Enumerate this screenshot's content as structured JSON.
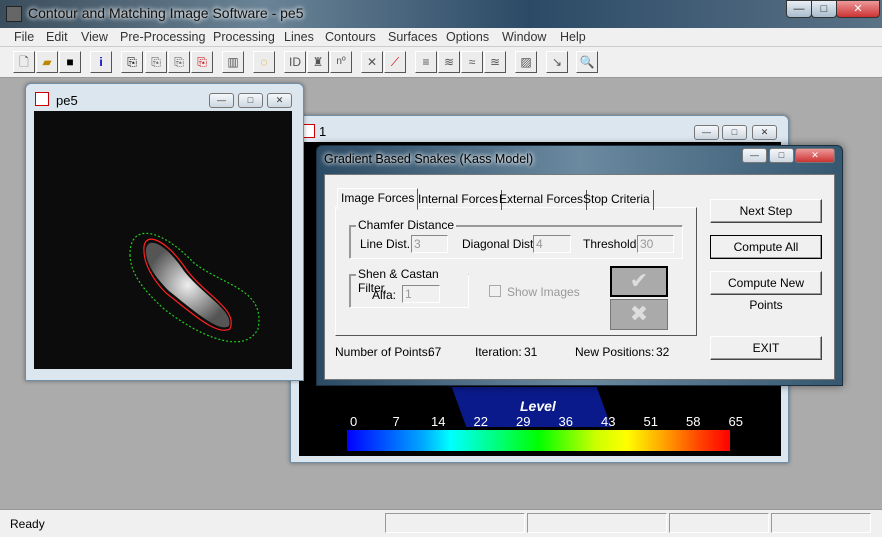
{
  "app": {
    "title": "Contour and Matching Image Software - pe5"
  },
  "menu": [
    "File",
    "Edit",
    "View",
    "Pre-Processing",
    "Processing",
    "Lines",
    "Contours",
    "Surfaces",
    "Options",
    "Window",
    "Help"
  ],
  "toolbar": [
    "new-icon",
    "open-icon",
    "save-icon",
    "info-icon",
    "copy-icon",
    "paste-icon",
    "paste-special-icon",
    "paste-red-icon",
    "film-icon",
    "contour-icon",
    "id-icon",
    "binoculars-icon",
    "number-icon",
    "cross-line-icon",
    "red-line-icon",
    "lines-icon",
    "lines2-icon",
    "lines3-icon",
    "lines4-icon",
    "hatch-icon",
    "arrow-icon",
    "zoom-icon"
  ],
  "toolbar_text": {
    "info": "i",
    "id": "ID",
    "n": "nº"
  },
  "image_window": {
    "title": "pe5"
  },
  "surface_window": {
    "title": "1",
    "colorbar": {
      "title": "Level",
      "ticks": [
        "0",
        "7",
        "14",
        "22",
        "29",
        "36",
        "43",
        "51",
        "58",
        "65"
      ]
    }
  },
  "dialog": {
    "title": "Gradient Based Snakes (Kass Model)",
    "tabs": [
      "Image Forces",
      "Internal Forces",
      "External Forces",
      "Stop Criteria"
    ],
    "active_tab": "Image Forces",
    "chamfer": {
      "label": "Chamfer Distance",
      "line_label": "Line Dist.:",
      "line_value": "3",
      "diag_label": "Diagonal Dist.:",
      "diag_value": "4",
      "thr_label": "Threshold:",
      "thr_value": "30"
    },
    "shen": {
      "label": "Shen & Castan Filter",
      "alfa_label": "Alfa:",
      "alfa_value": "1"
    },
    "show_images": "Show Images",
    "buttons": {
      "next": "Next Step",
      "compute_all": "Compute All",
      "compute_new": "Compute New Points",
      "exit": "EXIT"
    },
    "stats": {
      "points_label": "Number of Points:",
      "points": "67",
      "iter_label": "Iteration:",
      "iter": "31",
      "newpos_label": "New Positions:",
      "newpos": "32"
    }
  },
  "status": {
    "text": "Ready"
  },
  "colors": {
    "snake": "#ff2020",
    "band": "#22cc22"
  }
}
